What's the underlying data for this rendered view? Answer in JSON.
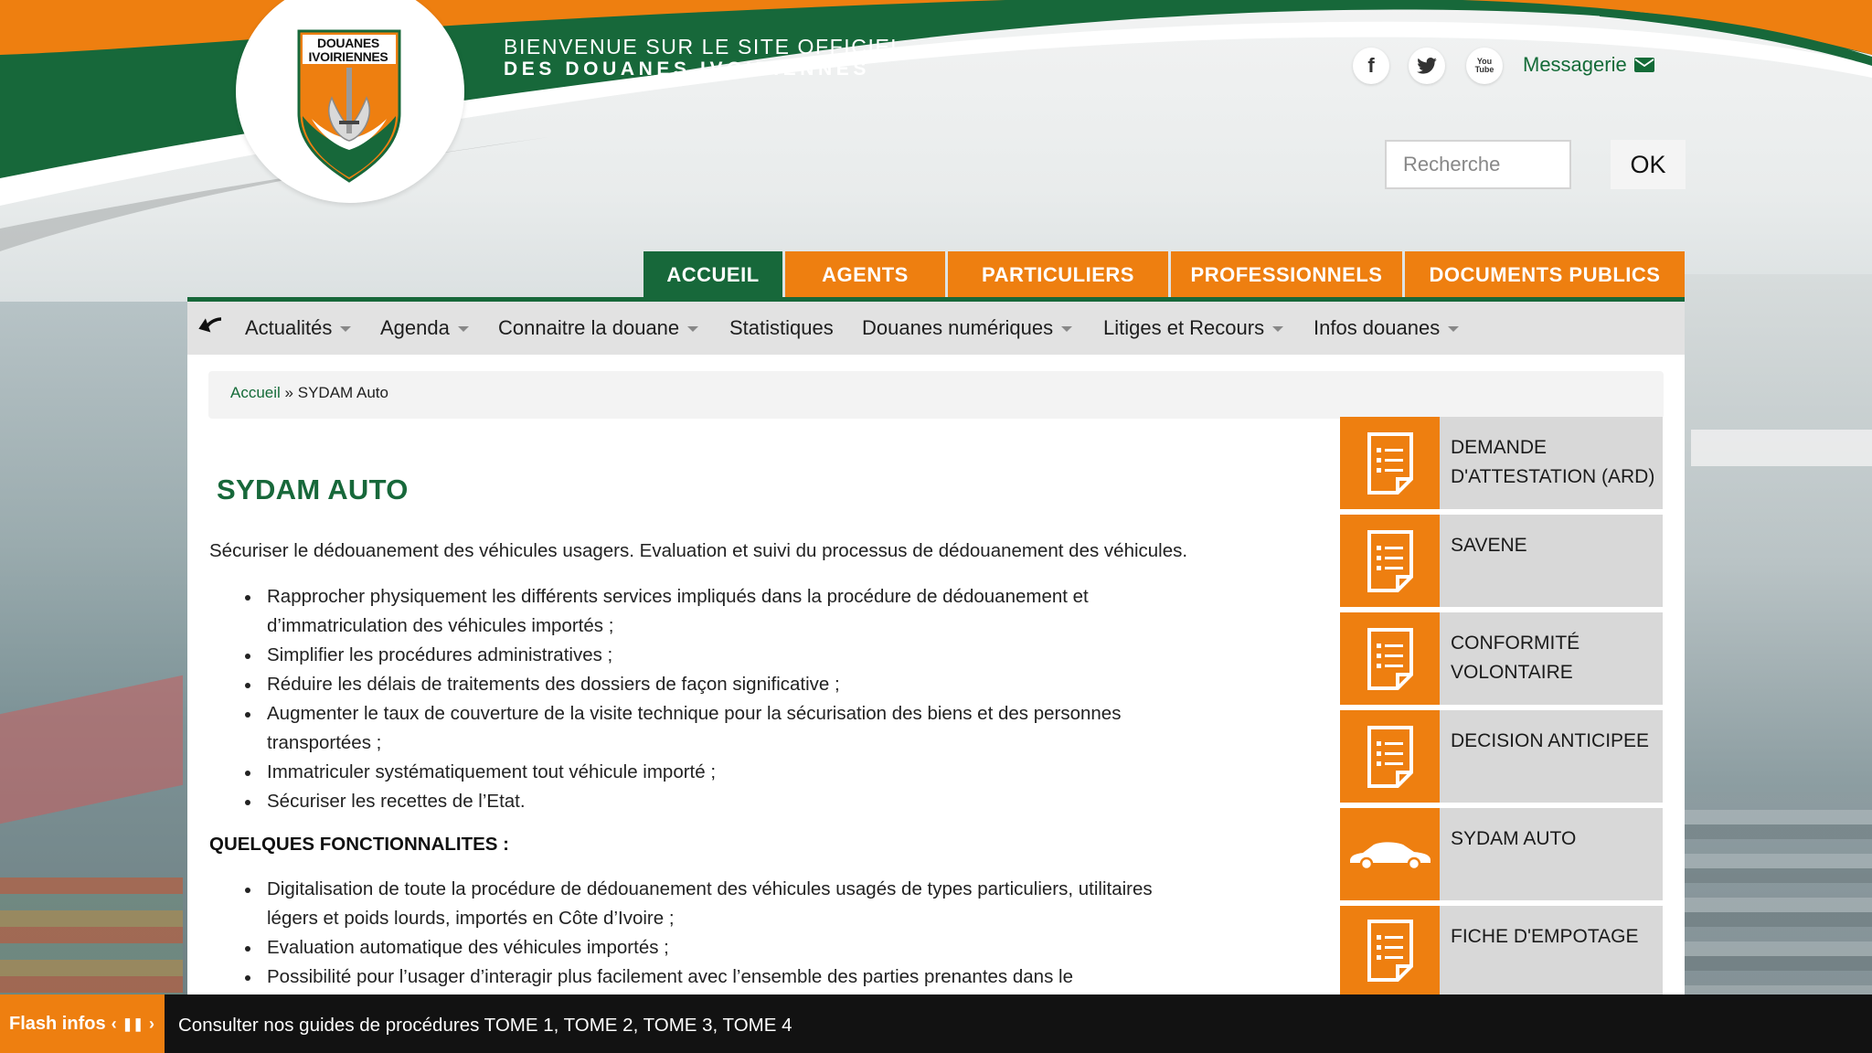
{
  "header": {
    "welcome_line1": "BIENVENUE SUR LE SITE OFFICIEL",
    "welcome_line2": "DES DOUANES IVOIRIENNES",
    "logo_text_line1": "DOUANES",
    "logo_text_line2": "IVOIRIENNES",
    "social": [
      {
        "name": "facebook-icon",
        "glyph": "f"
      },
      {
        "name": "twitter-icon",
        "glyph": "twitter"
      },
      {
        "name": "youtube-icon",
        "glyph": "You Tube"
      }
    ],
    "messagerie_label": "Messagerie",
    "search": {
      "placeholder": "Recherche",
      "button_label": "OK"
    }
  },
  "topnav": [
    {
      "label": "ACCUEIL",
      "active": true
    },
    {
      "label": "AGENTS",
      "active": false
    },
    {
      "label": "PARTICULIERS",
      "active": false
    },
    {
      "label": "PROFESSIONNELS",
      "active": false
    },
    {
      "label": "DOCUMENTS PUBLICS",
      "active": false
    }
  ],
  "subnav": [
    {
      "label": "Actualités",
      "dropdown": true
    },
    {
      "label": "Agenda",
      "dropdown": true
    },
    {
      "label": "Connaitre la douane",
      "dropdown": true
    },
    {
      "label": "Statistiques",
      "dropdown": false
    },
    {
      "label": "Douanes numériques",
      "dropdown": true
    },
    {
      "label": "Litiges et Recours",
      "dropdown": true
    },
    {
      "label": "Infos douanes",
      "dropdown": true
    }
  ],
  "breadcrumb": {
    "home": "Accueil",
    "separator": "»",
    "current": "SYDAM Auto"
  },
  "content": {
    "title": "SYDAM AUTO",
    "intro": "Sécuriser le dédouanement des véhicules usagers. Evaluation et suivi du processus de dédouanement des véhicules.",
    "objectives": [
      "Rapprocher physiquement les différents services impliqués dans la procédure de dédouanement et",
      "d’immatriculation des véhicules importés ;",
      "Simplifier les procédures administratives ;",
      "Réduire les délais de traitements des dossiers de façon significative ;",
      "Augmenter le taux de couverture de la visite technique pour la sécurisation des biens et des personnes",
      "transportées ;",
      "Immatriculer systématiquement tout véhicule importé ;",
      "Sécuriser les recettes de l’Etat."
    ],
    "features_heading": "QUELQUES FONCTIONNALITES :",
    "features": [
      "Digitalisation de toute la procédure de dédouanement des véhicules usagés de types particuliers, utilitaires",
      "légers et poids lourds, importés en Côte d’Ivoire ;",
      "Evaluation automatique des véhicules importés ;",
      "Possibilité pour l’usager d’interagir plus facilement avec l’ensemble des parties prenantes dans le"
    ]
  },
  "sidebar": [
    {
      "label": "DEMANDE D'ATTESTATION (ARD)",
      "icon": "document-icon"
    },
    {
      "label": "SAVENE",
      "icon": "document-icon"
    },
    {
      "label": "CONFORMITÉ VOLONTAIRE",
      "icon": "document-icon"
    },
    {
      "label": "DECISION ANTICIPEE",
      "icon": "document-icon"
    },
    {
      "label": "SYDAM AUTO",
      "icon": "car-icon"
    },
    {
      "label": "FICHE D'EMPOTAGE",
      "icon": "document-icon"
    }
  ],
  "flash": {
    "label": "Flash infos",
    "message": "Consulter nos guides de procédures TOME 1, TOME 2, TOME 3, TOME 4"
  },
  "colors": {
    "green": "#17683a",
    "orange": "#ee7f10",
    "dark": "#121212"
  }
}
